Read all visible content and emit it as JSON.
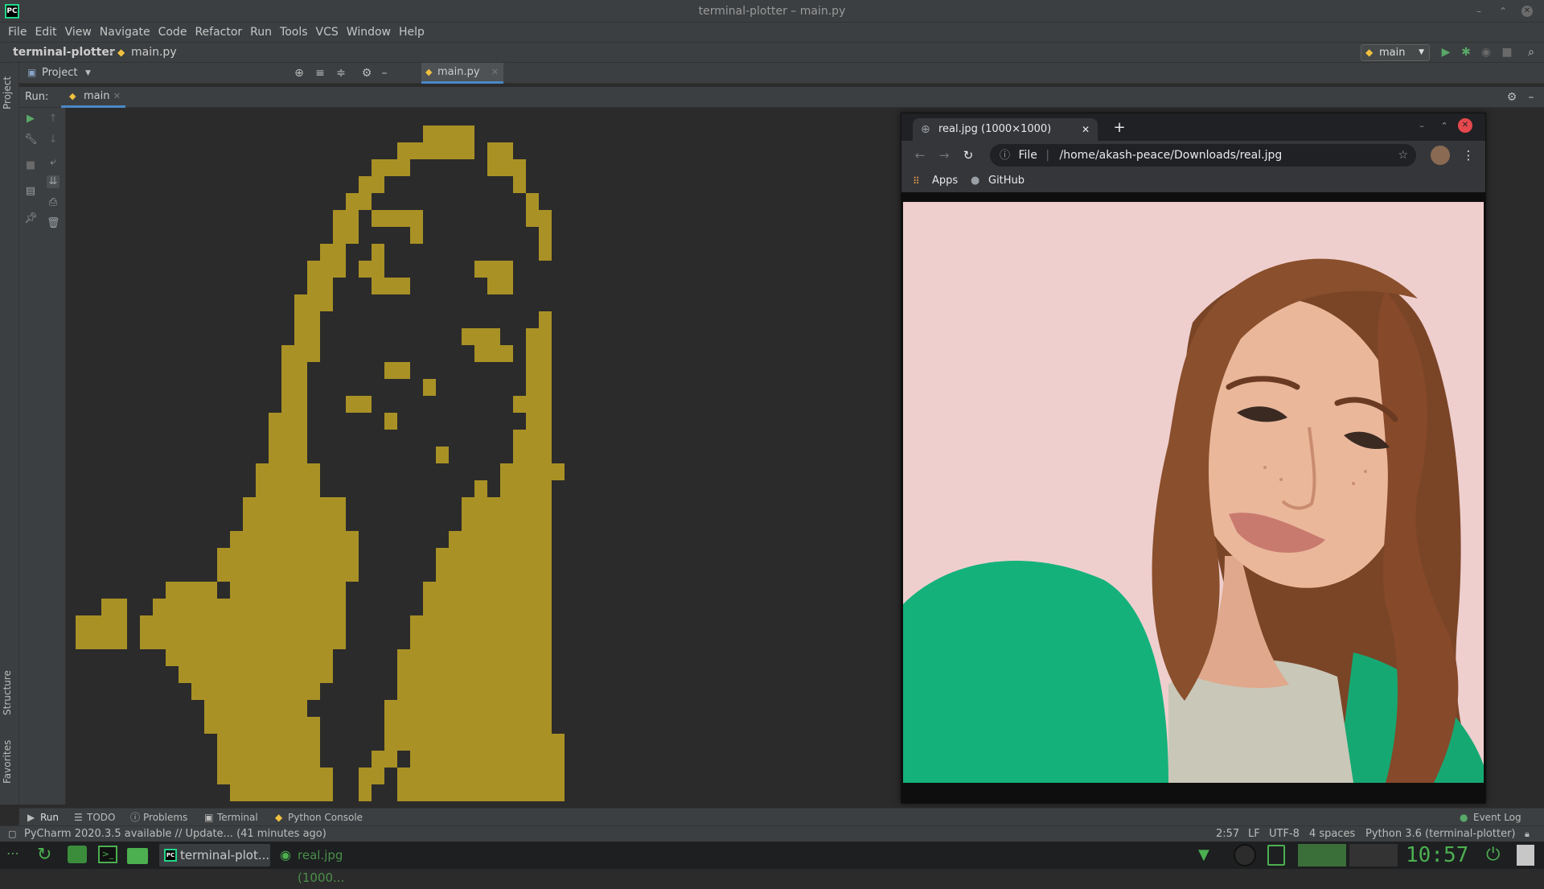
{
  "window": {
    "title": "terminal-plotter – main.py",
    "app_logo": "PC",
    "controls": [
      "–",
      "⌃",
      "✕"
    ]
  },
  "menu": [
    "File",
    "Edit",
    "View",
    "Navigate",
    "Code",
    "Refactor",
    "Run",
    "Tools",
    "VCS",
    "Window",
    "Help"
  ],
  "nav": {
    "project": "terminal-plotter",
    "file": "main.py",
    "run_config": "main"
  },
  "project_panel": {
    "label": "Project",
    "editor_tab": "main.py"
  },
  "run_panel": {
    "label": "Run:",
    "tab": "main"
  },
  "side_tabs": {
    "project": "Project",
    "structure": "Structure",
    "favorites": "Favorites"
  },
  "browser": {
    "tab_title": "real.jpg (1000×1000)",
    "scheme_label": "File",
    "url": "/home/akash-peace/Downloads/real.jpg",
    "bookmarks": [
      "Apps",
      "GitHub"
    ]
  },
  "bottom_tabs": [
    "Run",
    "TODO",
    "Problems",
    "Terminal",
    "Python Console"
  ],
  "event_log": "Event Log",
  "status": {
    "message": "PyCharm 2020.3.5 available // Update... (41 minutes ago)",
    "position": "2:57",
    "line_sep": "LF",
    "encoding": "UTF-8",
    "indent": "4 spaces",
    "interpreter": "Python 3.6 (terminal-plotter)"
  },
  "taskbar": {
    "items": [
      "terminal-plot...",
      "real.jpg (1000..."
    ],
    "clock": "10:57"
  },
  "colors": {
    "plot_fill": "#a99125",
    "accent": "#4a88c7",
    "ide_bg": "#2b2b2b"
  }
}
